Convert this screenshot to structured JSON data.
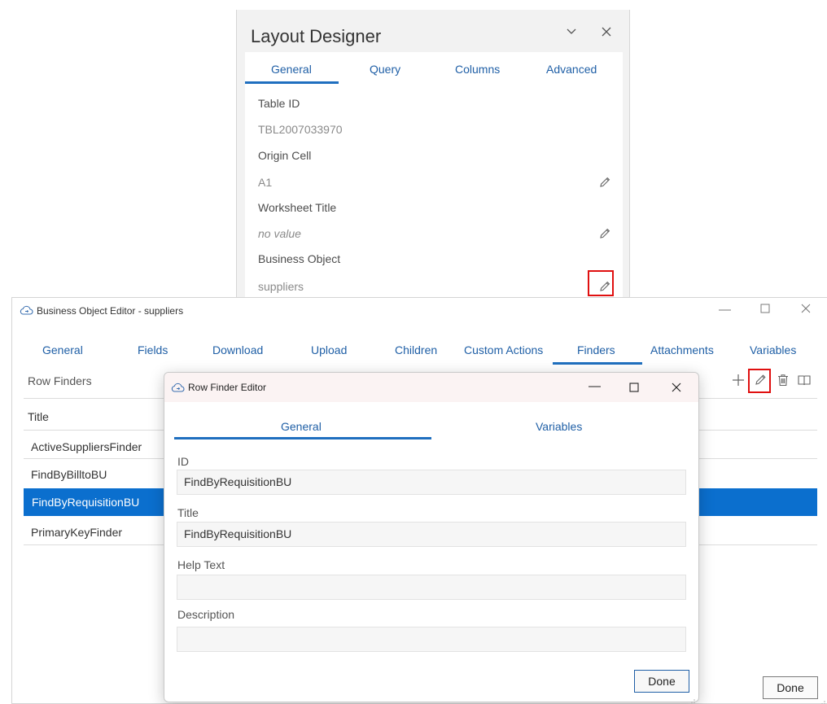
{
  "layout_designer": {
    "title": "Layout Designer",
    "tabs": [
      "General",
      "Query",
      "Columns",
      "Advanced"
    ],
    "active_tab": "General",
    "fields": [
      {
        "label": "Table ID",
        "value": "TBL2007033970",
        "editable": false
      },
      {
        "label": "Origin Cell",
        "value": "A1",
        "editable": true
      },
      {
        "label": "Worksheet Title",
        "value": "no value",
        "editable": true
      },
      {
        "label": "Business Object",
        "value": "suppliers",
        "editable": true
      }
    ]
  },
  "bo_editor": {
    "title": "Business Object Editor - suppliers",
    "tabs": [
      "General",
      "Fields",
      "Download",
      "Upload",
      "Children",
      "Custom Actions",
      "Finders",
      "Attachments",
      "Variables"
    ],
    "active_tab": "Finders",
    "section_label": "Row Finders",
    "table": {
      "header": "Title",
      "rows": [
        "ActiveSuppliersFinder",
        "FindByBilltoBU",
        "FindByRequisitionBU",
        "PrimaryKeyFinder"
      ],
      "selected": "FindByRequisitionBU"
    },
    "done_label": "Done"
  },
  "row_finder_editor": {
    "title": "Row Finder Editor",
    "tabs": [
      "General",
      "Variables"
    ],
    "active_tab": "General",
    "fields": [
      {
        "label": "ID",
        "value": "FindByRequisitionBU"
      },
      {
        "label": "Title",
        "value": "FindByRequisitionBU"
      },
      {
        "label": "Help Text",
        "value": ""
      },
      {
        "label": "Description",
        "value": ""
      }
    ],
    "done_label": "Done"
  },
  "colors": {
    "accent": "#1f6fbf",
    "selection": "#0b6fce",
    "highlight": "#e01010"
  }
}
